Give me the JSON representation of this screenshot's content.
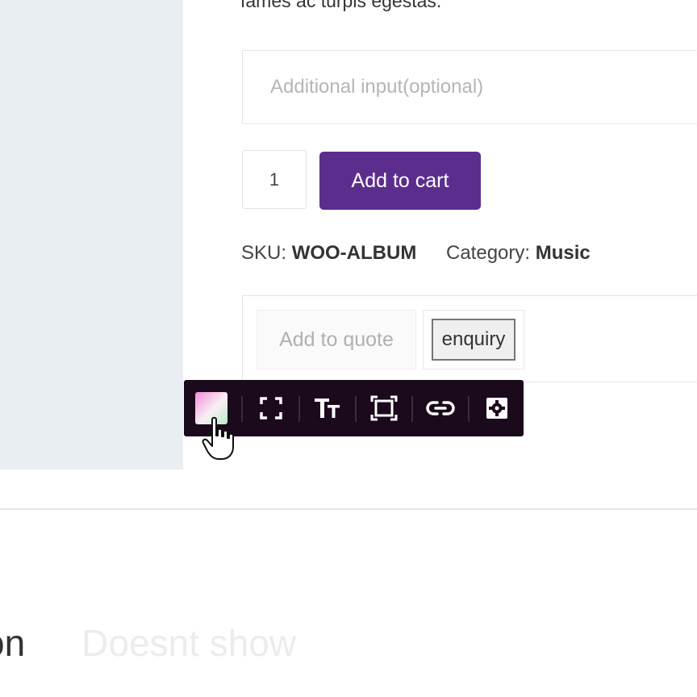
{
  "product": {
    "description_tail": "fames ac turpis egestas.",
    "additional_input": {
      "placeholder": "Additional input(optional)",
      "value": ""
    },
    "quantity": "1",
    "add_to_cart_label": "Add to cart",
    "sku_label": "SKU:",
    "sku_value": "WOO-ALBUM",
    "category_label": "Category:",
    "category_value": "Music"
  },
  "quote": {
    "add_to_quote_label": "Add to quote",
    "enquiry_label": "enquiry"
  },
  "toolbar": {
    "items": [
      {
        "name": "color-picker",
        "icon": "gradient-swatch-icon"
      },
      {
        "name": "fullscreen",
        "icon": "expand-icon"
      },
      {
        "name": "typography",
        "icon": "text-size-icon"
      },
      {
        "name": "spacing",
        "icon": "frame-icon"
      },
      {
        "name": "link",
        "icon": "link-icon"
      },
      {
        "name": "settings",
        "icon": "gear-icon"
      }
    ],
    "background": "#1b0a1c"
  },
  "section": {
    "title_fragment": "on",
    "ghost_text": "Doesnt show"
  },
  "colors": {
    "button_purple": "#5b2e8e",
    "image_panel": "#e8eef1"
  }
}
